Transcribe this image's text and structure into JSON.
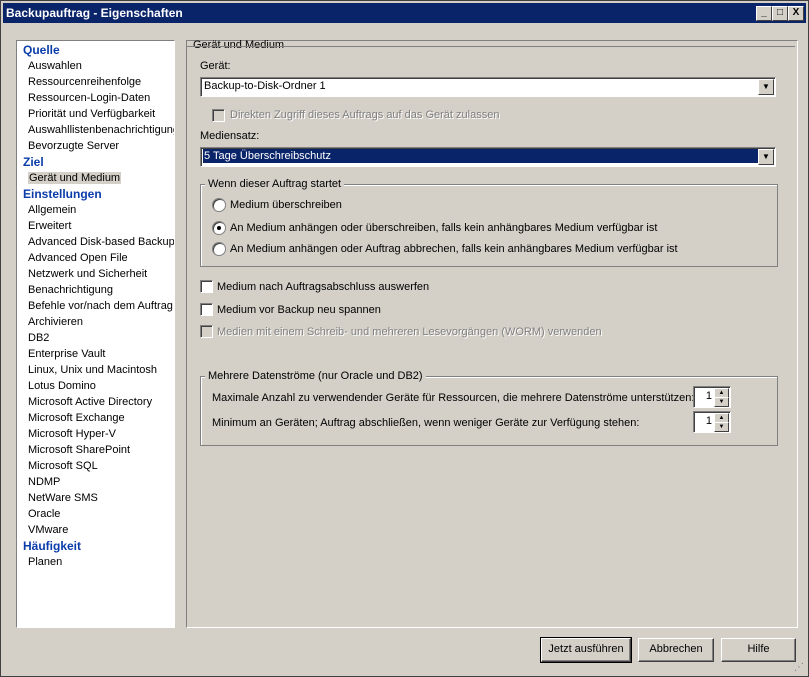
{
  "window": {
    "title": "Backupauftrag - Eigenschaften",
    "minimize": "_",
    "maximize": "□",
    "close": "X"
  },
  "tree": {
    "sections": [
      {
        "title": "Quelle",
        "items": [
          "Auswahlen",
          "Ressourcenreihenfolge",
          "Ressourcen-Login-Daten",
          "Priorität und Verfügbarkeit",
          "Auswahllistenbenachrichtigung",
          "Bevorzugte Server"
        ]
      },
      {
        "title": "Ziel",
        "items": [
          "Gerät und Medium"
        ]
      },
      {
        "title": "Einstellungen",
        "items": [
          "Allgemein",
          "Erweitert",
          "Advanced Disk-based Backup",
          "Advanced Open File",
          "Netzwerk und Sicherheit",
          "Benachrichtigung",
          "Befehle vor/nach dem Auftrag",
          "Archivieren",
          "DB2",
          "Enterprise Vault",
          "Linux, Unix und Macintosh",
          "Lotus Domino",
          "Microsoft Active Directory",
          "Microsoft Exchange",
          "Microsoft Hyper-V",
          "Microsoft SharePoint",
          "Microsoft SQL",
          "NDMP",
          "NetWare SMS",
          "Oracle",
          "VMware"
        ]
      },
      {
        "title": "Häufigkeit",
        "items": [
          "Planen"
        ]
      }
    ],
    "selected": "Gerät und Medium"
  },
  "panel": {
    "group_title": "Gerät und Medium",
    "device_label": "Gerät:",
    "device_value": "Backup-to-Disk-Ordner 1",
    "direct_access_label": "Direkten Zugriff dieses Auftrags auf das Gerät zulassen",
    "mediaset_label": "Mediensatz:",
    "mediaset_value": "5 Tage Überschreibschutz",
    "when_group_title": "Wenn dieser Auftrag startet",
    "radio_overwrite": "Medium überschreiben",
    "radio_append_overwrite": "An Medium anhängen oder überschreiben, falls kein anhängbares Medium verfügbar ist",
    "radio_append_abort": "An Medium anhängen oder Auftrag abbrechen, falls kein anhängbares Medium verfügbar ist",
    "eject_label": "Medium nach Auftragsabschluss auswerfen",
    "retension_label": "Medium vor Backup neu spannen",
    "worm_label": "Medien mit einem Schreib- und mehreren Lesevorgängen (WORM) verwenden",
    "streams_group_title": "Mehrere Datenströme (nur Oracle und DB2)",
    "max_devices_label": "Maximale Anzahl zu verwendender Geräte für Ressourcen, die mehrere Datenströme unterstützen:",
    "max_devices_value": "1",
    "min_devices_label": "Minimum an Geräten; Auftrag abschließen, wenn weniger Geräte zur Verfügung stehen:",
    "min_devices_value": "1"
  },
  "buttons": {
    "run_now": "Jetzt ausführen",
    "cancel": "Abbrechen",
    "help": "Hilfe"
  }
}
